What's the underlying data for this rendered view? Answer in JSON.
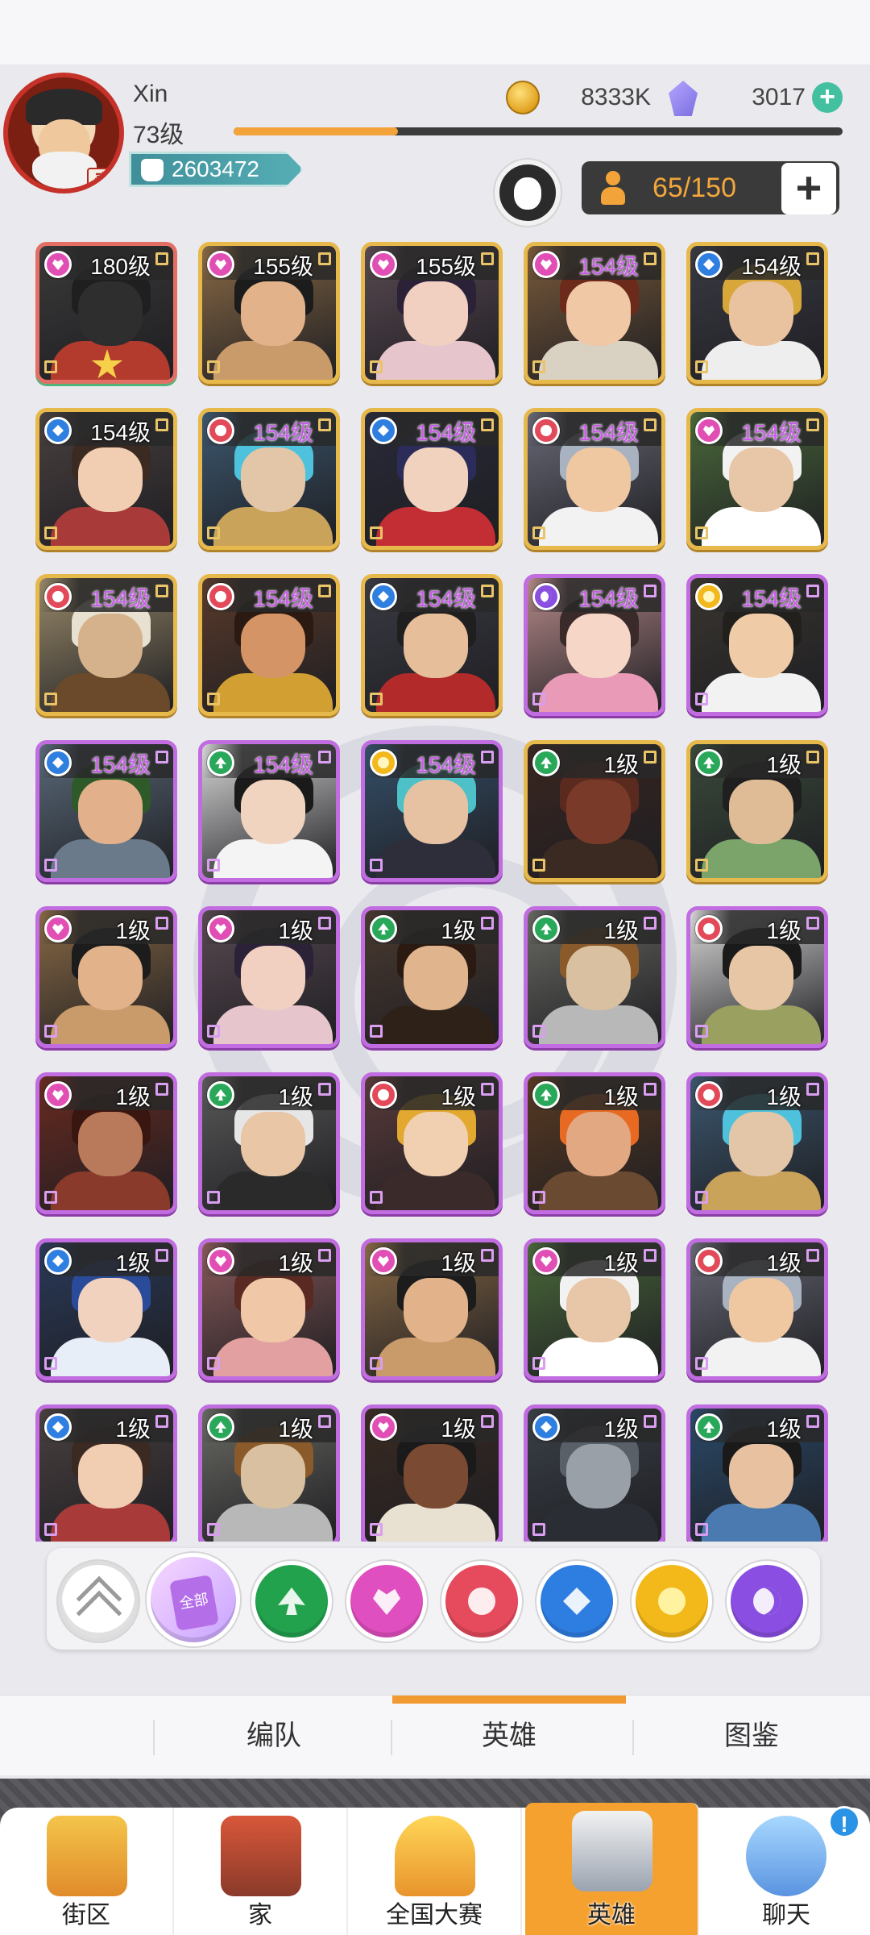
{
  "player": {
    "name": "Xin",
    "level": "73级",
    "xp_progress": 0.27,
    "power": "2603472",
    "avatar_seal": "秦"
  },
  "currency": {
    "coins": "8333K",
    "gems": "3017",
    "coin_icon": "coin-icon",
    "gem_icon": "gem-icon",
    "add_icon": "plus-icon"
  },
  "hero_count": "65/150",
  "add_slot_label": "+",
  "colors": {
    "accent_orange": "#f29a32",
    "gold_frame": "#e7b84a",
    "purple_frame": "#c16ce0",
    "count_text": "#f3a63b"
  },
  "heroes": [
    {
      "level": "180级",
      "suit": "heart",
      "frame": "rainbow",
      "hl": false,
      "star": true,
      "bg": "#3a3a3a",
      "hair": "#1f1f1f",
      "skin": "#2e2e2e",
      "cloth": "#b23b2e"
    },
    {
      "level": "155级",
      "suit": "heart",
      "frame": "gold",
      "hl": false,
      "bg": "#8a6a45",
      "hair": "#1c1c1c",
      "skin": "#e2b38a",
      "cloth": "#c99a6a"
    },
    {
      "level": "155级",
      "suit": "heart",
      "frame": "gold",
      "hl": false,
      "bg": "#5a4a52",
      "hair": "#2c2238",
      "skin": "#f1d0c2",
      "cloth": "#e6c6cc"
    },
    {
      "level": "154级",
      "suit": "heart",
      "frame": "gold",
      "hl": true,
      "bg": "#7a5a3a",
      "hair": "#6b2a1a",
      "skin": "#f0c8a6",
      "cloth": "#d9d2c2"
    },
    {
      "level": "154级",
      "suit": "diamond",
      "frame": "gold",
      "hl": false,
      "bg": "#3a3a44",
      "hair": "#d7a73a",
      "skin": "#e9c2a0",
      "cloth": "#eeeeee"
    },
    {
      "level": "154级",
      "suit": "diamond",
      "frame": "gold",
      "hl": false,
      "bg": "#4a4040",
      "hair": "#3a2a22",
      "skin": "#f1cdb2",
      "cloth": "#a83a3a"
    },
    {
      "level": "154级",
      "suit": "club",
      "frame": "gold",
      "hl": true,
      "bg": "#3c5870",
      "hair": "#4ec2dc",
      "skin": "#e3c6a8",
      "cloth": "#c9a35a"
    },
    {
      "level": "154级",
      "suit": "diamond",
      "frame": "gold",
      "hl": true,
      "bg": "#2a2a3a",
      "hair": "#2c2c5a",
      "skin": "#f0d2be",
      "cloth": "#c32d34"
    },
    {
      "level": "154级",
      "suit": "club",
      "frame": "gold",
      "hl": true,
      "bg": "#6a6a78",
      "hair": "#a8b2c0",
      "skin": "#efc8a2",
      "cloth": "#f2f2f2"
    },
    {
      "level": "154级",
      "suit": "heart",
      "frame": "gold",
      "hl": true,
      "bg": "#4a6a3a",
      "hair": "#f2f2f2",
      "skin": "#e8c7a8",
      "cloth": "#ffffff"
    },
    {
      "level": "154级",
      "suit": "club",
      "frame": "gold",
      "hl": true,
      "bg": "#9a8a6a",
      "hair": "#e8e0d0",
      "skin": "#d6b28c",
      "cloth": "#6a4a2a"
    },
    {
      "level": "154级",
      "suit": "club",
      "frame": "gold",
      "hl": true,
      "bg": "#5a3a2a",
      "hair": "#2a1a12",
      "skin": "#d49466",
      "cloth": "#d2a032"
    },
    {
      "level": "154级",
      "suit": "diamond",
      "frame": "gold",
      "hl": true,
      "bg": "#3a3a44",
      "hair": "#1f1f1f",
      "skin": "#e6bf9a",
      "cloth": "#b22a2a"
    },
    {
      "level": "154级",
      "suit": "moon",
      "frame": "purple",
      "hl": true,
      "bg": "#b78a8a",
      "hair": "#3a2a2a",
      "skin": "#f6d6c6",
      "cloth": "#e89ab6"
    },
    {
      "level": "154级",
      "suit": "sun",
      "frame": "purple",
      "hl": true,
      "bg": "#3a3630",
      "hair": "#22201c",
      "skin": "#efcba8",
      "cloth": "#f2f2f2"
    },
    {
      "level": "154级",
      "suit": "diamond",
      "frame": "purple",
      "hl": true,
      "bg": "#5a6a7a",
      "hair": "#2e5a2a",
      "skin": "#e2b08a",
      "cloth": "#6a7a8a"
    },
    {
      "level": "154级",
      "suit": "spade",
      "frame": "purple",
      "hl": true,
      "bg": "#dadada",
      "hair": "#1a1a1a",
      "skin": "#f0d4c0",
      "cloth": "#f4f4f4"
    },
    {
      "level": "154级",
      "suit": "sun",
      "frame": "purple",
      "hl": true,
      "bg": "#35506a",
      "hair": "#4dc0c8",
      "skin": "#e6c2a2",
      "cloth": "#2e2e3a"
    },
    {
      "level": "1级",
      "suit": "spade",
      "frame": "gold",
      "hl": false,
      "bg": "#3a2620",
      "hair": "#5a2a1e",
      "skin": "#7a3a2a",
      "cloth": "#3a2a22"
    },
    {
      "level": "1级",
      "suit": "spade",
      "frame": "gold",
      "hl": false,
      "bg": "#3a4a3a",
      "hair": "#1f1f1f",
      "skin": "#e0bc96",
      "cloth": "#7aa46a"
    },
    {
      "level": "1级",
      "suit": "heart",
      "frame": "purple",
      "hl": false,
      "bg": "#8a6a45",
      "hair": "#1c1c1c",
      "skin": "#e2b38a",
      "cloth": "#c99a6a"
    },
    {
      "level": "1级",
      "suit": "heart",
      "frame": "purple",
      "hl": false,
      "bg": "#5a4a52",
      "hair": "#2c2238",
      "skin": "#f1d0c2",
      "cloth": "#e6c6cc"
    },
    {
      "level": "1级",
      "suit": "spade",
      "frame": "purple",
      "hl": false,
      "bg": "#4a3a30",
      "hair": "#2a1a12",
      "skin": "#e0b48c",
      "cloth": "#2e2218"
    },
    {
      "level": "1级",
      "suit": "spade",
      "frame": "purple",
      "hl": false,
      "bg": "#6a6a64",
      "hair": "#8a5a2a",
      "skin": "#d8c0a0",
      "cloth": "#b8b8b8"
    },
    {
      "level": "1级",
      "suit": "club",
      "frame": "purple",
      "hl": false,
      "bg": "#dadada",
      "hair": "#1a1a1a",
      "skin": "#e6c6a4",
      "cloth": "#9aa060"
    },
    {
      "level": "1级",
      "suit": "heart",
      "frame": "purple",
      "hl": false,
      "bg": "#6a2a20",
      "hair": "#3a1610",
      "skin": "#b87a5a",
      "cloth": "#8a3a2a"
    },
    {
      "level": "1级",
      "suit": "spade",
      "frame": "purple",
      "hl": false,
      "bg": "#5a5a5a",
      "hair": "#e6e6e6",
      "skin": "#e8c6a6",
      "cloth": "#2a2a2a"
    },
    {
      "level": "1级",
      "suit": "club",
      "frame": "purple",
      "hl": false,
      "bg": "#5a3a3a",
      "hair": "#e2a830",
      "skin": "#f0d0b0",
      "cloth": "#3a2a2a"
    },
    {
      "level": "1级",
      "suit": "spade",
      "frame": "purple",
      "hl": false,
      "bg": "#5a3a22",
      "hair": "#e86a22",
      "skin": "#e2a882",
      "cloth": "#6a4a30"
    },
    {
      "level": "1级",
      "suit": "club",
      "frame": "purple",
      "hl": false,
      "bg": "#3c5870",
      "hair": "#4ec2dc",
      "skin": "#e3c6a8",
      "cloth": "#c9a35a"
    },
    {
      "level": "1级",
      "suit": "diamond",
      "frame": "purple",
      "hl": false,
      "bg": "#2a3a5a",
      "hair": "#2a4a9a",
      "skin": "#f0d2be",
      "cloth": "#e8eef8"
    },
    {
      "level": "1级",
      "suit": "heart",
      "frame": "purple",
      "hl": false,
      "bg": "#8a5a5a",
      "hair": "#5a2a22",
      "skin": "#f0c8a8",
      "cloth": "#e2a0a0"
    },
    {
      "level": "1级",
      "suit": "heart",
      "frame": "purple",
      "hl": false,
      "bg": "#8a6a45",
      "hair": "#1c1c1c",
      "skin": "#e2b38a",
      "cloth": "#c99a6a"
    },
    {
      "level": "1级",
      "suit": "heart",
      "frame": "purple",
      "hl": false,
      "bg": "#4a6a3a",
      "hair": "#f2f2f2",
      "skin": "#e8c7a8",
      "cloth": "#ffffff"
    },
    {
      "level": "1级",
      "suit": "club",
      "frame": "purple",
      "hl": false,
      "bg": "#6a6a78",
      "hair": "#a8b2c0",
      "skin": "#efc8a2",
      "cloth": "#f2f2f2"
    },
    {
      "level": "1级",
      "suit": "diamond",
      "frame": "purple",
      "hl": false,
      "bg": "#4a4040",
      "hair": "#3a2a22",
      "skin": "#f1cdb2",
      "cloth": "#a83a3a"
    },
    {
      "level": "1级",
      "suit": "spade",
      "frame": "purple",
      "hl": false,
      "bg": "#6a6a64",
      "hair": "#8a5a2a",
      "skin": "#d8c0a0",
      "cloth": "#b8b8b8"
    },
    {
      "level": "1级",
      "suit": "heart",
      "frame": "purple",
      "hl": false,
      "bg": "#3a2a22",
      "hair": "#1a1a1a",
      "skin": "#7a4a32",
      "cloth": "#e8e0d0"
    },
    {
      "level": "1级",
      "suit": "diamond",
      "frame": "purple",
      "hl": false,
      "bg": "#3a4048",
      "hair": "#5a6068",
      "skin": "#9aa0a8",
      "cloth": "#2a2e34"
    },
    {
      "level": "1级",
      "suit": "spade",
      "frame": "purple",
      "hl": false,
      "bg": "#2a4a6a",
      "hair": "#1a1a1a",
      "skin": "#e8c2a0",
      "cloth": "#4a7ab0"
    }
  ],
  "filters": {
    "all_label": "全部",
    "items": [
      "spade",
      "heart",
      "club",
      "diamond",
      "sun",
      "moon"
    ]
  },
  "tabs": [
    {
      "label": "编队",
      "active": false
    },
    {
      "label": "英雄",
      "active": true
    },
    {
      "label": "图鉴",
      "active": false
    }
  ],
  "nav": [
    {
      "label": "街区",
      "icon": "signpost-icon",
      "active": false
    },
    {
      "label": "家",
      "icon": "house-icon",
      "active": false
    },
    {
      "label": "全国大赛",
      "icon": "trophy-icon",
      "active": false
    },
    {
      "label": "英雄",
      "icon": "hero-cards-icon",
      "active": true
    },
    {
      "label": "聊天",
      "icon": "chat-bubble-icon",
      "active": false
    }
  ],
  "chat_badge": "!"
}
